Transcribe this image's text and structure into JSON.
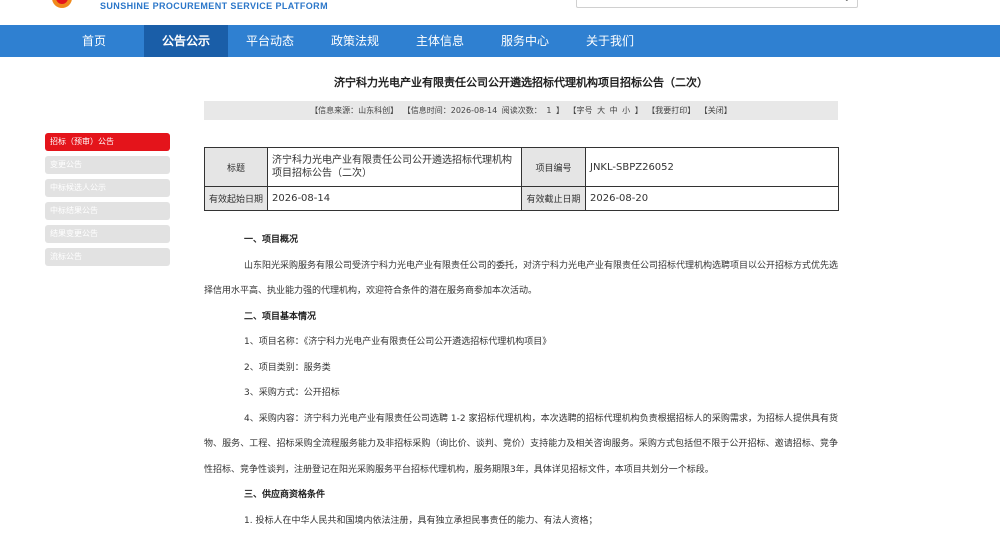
{
  "header": {
    "brand_en": "SUNSHINE PROCUREMENT SERVICE PLATFORM",
    "search_placeholder": ""
  },
  "nav": {
    "items": [
      {
        "label": "首页"
      },
      {
        "label": "公告公示"
      },
      {
        "label": "平台动态"
      },
      {
        "label": "政策法规"
      },
      {
        "label": "主体信息"
      },
      {
        "label": "服务中心"
      },
      {
        "label": "关于我们"
      }
    ],
    "active_index": 1
  },
  "sidebar": {
    "items": [
      {
        "label": "招标（预审）公告"
      },
      {
        "label": "变更公告"
      },
      {
        "label": "中标候选人公示"
      },
      {
        "label": "中标结果公告"
      },
      {
        "label": "结果变更公告"
      },
      {
        "label": "流标公告"
      }
    ],
    "active_index": 0
  },
  "article": {
    "title": "济宁科力光电产业有限责任公司公开遴选招标代理机构项目招标公告（二次）",
    "meta": {
      "source": "【信息来源：山东科创】",
      "time": "【信息时间：2026-08-14",
      "views": "阅读次数：",
      "views_count": "1",
      "views_close": "】",
      "font_size": "【字号",
      "font_large": "大",
      "font_medium": "中",
      "font_small": "小",
      "font_close": "】",
      "print": "【我要打印】",
      "close": "【关闭】"
    },
    "table": {
      "title_label": "标题",
      "title_value": "济宁科力光电产业有限责任公司公开遴选招标代理机构项目招标公告（二次）",
      "project_no_label": "项目编号",
      "project_no_value": "JNKL-SBPZ26052",
      "start_label": "有效起始日期",
      "start_value": "2026-08-14",
      "end_label": "有效截止日期",
      "end_value": "2026-08-20"
    },
    "sections": {
      "s1_title": "一、项目概况",
      "s1_text": "山东阳光采购服务有限公司受济宁科力光电产业有限责任公司的委托，对济宁科力光电产业有限责任公司招标代理机构选聘项目以公开招标方式优先选择信用水平高、执业能力强的代理机构，欢迎符合条件的潜在服务商参加本次活动。",
      "s2_title": "二、项目基本情况",
      "s2_item1": "1、项目名称：《济宁科力光电产业有限责任公司公开遴选招标代理机构项目》",
      "s2_item2": "2、项目类别：服务类",
      "s2_item3": "3、采购方式：公开招标",
      "s2_item4": "4、采购内容：济宁科力光电产业有限责任公司选聘 1-2 家招标代理机构，本次选聘的招标代理机构负责根据招标人的采购需求，为招标人提供具有货物、服务、工程、招标采购全流程服务能力及非招标采购（询比价、谈判、竞价）支持能力及相关咨询服务。采购方式包括但不限于公开招标、邀请招标、竞争性招标、竞争性谈判，注册登记在阳光采购服务平台招标代理机构，服务期限3年，具体详见招标文件，本项目共划分一个标段。",
      "s3_title": "三、供应商资格条件",
      "s3_item1": "1. 投标人在中华人民共和国境内依法注册，具有独立承担民事责任的能力、有法人资格；"
    }
  },
  "colors": {
    "nav_bg": "#2f80d1",
    "nav_active_bg": "#1a5ea8",
    "sidebar_active": "#e4141b",
    "sidebar_inactive": "#e2e2e2",
    "brand_text": "#2a76c9"
  },
  "icons": [
    "logo-icon",
    "chevron-down-icon"
  ]
}
